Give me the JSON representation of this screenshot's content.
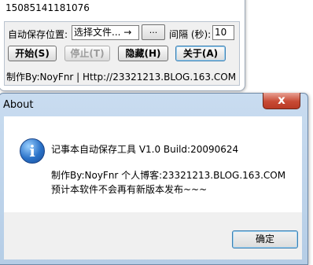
{
  "main_window": {
    "title": "15085141181076",
    "save_location_label": "自动保存位置:",
    "path_select_value": "选择文件... →",
    "browse_label": "...",
    "interval_label": "间隔 (秒):",
    "interval_value": "10",
    "buttons": {
      "start": "开始(S)",
      "stop": "停止(T)",
      "hide": "隐藏(H)",
      "about": "关于(A)"
    },
    "status_text": "制作By:NoyFnr | Http://23321213.BLOG.163.COM"
  },
  "about_dialog": {
    "title": "About",
    "close_label": "x",
    "icon": "info-icon",
    "line1": "记事本自动保存工具 V1.0 Build:20090624",
    "line2": "制作By:NoyFnr 个人博客:23321213.BLOG.163.COM",
    "line3": "预计本软件不会再有新版本发布~~~",
    "ok_label": "确定"
  }
}
